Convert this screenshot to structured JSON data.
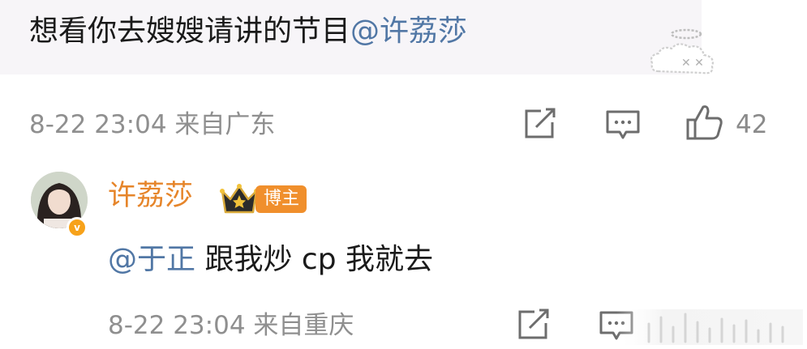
{
  "comment": {
    "text": "想看你去嫂嫂请讲的节目",
    "mention": "@许荔莎",
    "time": "8-22 23:04",
    "location": "来自广东",
    "like_count": "42"
  },
  "reply": {
    "username": "许荔莎",
    "badge": "博主",
    "mention": "@于正",
    "text": " 跟我炒 cp 我就去",
    "time": "8-22 23:04",
    "location": "来自重庆"
  },
  "icons": {
    "repost": "share-icon",
    "comment": "comment-icon",
    "like": "thumbs-up-icon",
    "verified": "verified-badge-icon",
    "crown": "crown-icon",
    "sticker": "angel-cloud-sticker"
  },
  "colors": {
    "mention": "#5177a5",
    "username": "#e6852a",
    "badge": "#f08f2c",
    "meta": "#8f8f8f",
    "bubble": "#f7f5f8"
  }
}
